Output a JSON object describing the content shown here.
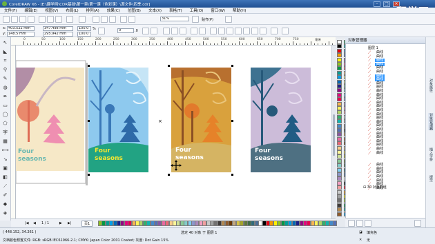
{
  "app": {
    "title": "CorelDRAW X6 - [E:\\翻学网\\CDR基础\\第一章\\第一课（色彩课）\\源文件\\四季.cdr]",
    "watermark": "翻学网",
    "watermark_sub": "qianxue.com"
  },
  "menu": [
    "文件(F)",
    "编辑(E)",
    "视图(V)",
    "布局(L)",
    "排列(A)",
    "效果(C)",
    "位图(B)",
    "文本(X)",
    "表格(T)",
    "工具(O)",
    "窗口(W)",
    "帮助(H)"
  ],
  "toolbar": {
    "zoom": "31%",
    "snap": "贴齐(P)",
    "angle": "0",
    "angle_unit": ".0"
  },
  "property_bar": {
    "x": "403.522 mm",
    "y": "148.5 mm",
    "width": "347.498 mm",
    "height": "295.942 mm",
    "scale_x": "100.0",
    "scale_y": "100.0",
    "scale_unit": "%"
  },
  "ruler": {
    "labels": [
      "0",
      "50",
      "100",
      "150",
      "200",
      "250",
      "300",
      "350",
      "400",
      "450",
      "500",
      "550",
      "600",
      "650",
      "700",
      "750",
      "毫米"
    ]
  },
  "cards": [
    {
      "title1": "Four",
      "title2": "seasons"
    },
    {
      "title1": "Four",
      "title2": "seasons"
    },
    {
      "title1": "Four",
      "title2": "seasons"
    },
    {
      "title1": "Four",
      "title2": "seasons"
    }
  ],
  "docker": {
    "title": "对象管理器",
    "header_layer": "图层 1",
    "group_label": "30 对象群组",
    "items": [
      {
        "label": "曲线",
        "selected": false
      },
      {
        "label": "曲线",
        "selected": false
      },
      {
        "label": "曲线",
        "selected": true
      },
      {
        "label": "曲线",
        "selected": true
      },
      {
        "label": "曲线",
        "selected": false
      },
      {
        "label": "曲线",
        "selected": false
      },
      {
        "label": "曲线",
        "selected": true
      },
      {
        "label": "曲线",
        "selected": true
      },
      {
        "label": "曲线",
        "selected": false
      },
      {
        "label": "曲线",
        "selected": false
      },
      {
        "label": "曲线",
        "selected": false
      },
      {
        "label": "曲线",
        "selected": false
      },
      {
        "label": "曲线",
        "selected": false
      },
      {
        "label": "曲线",
        "selected": false
      },
      {
        "label": "曲线",
        "selected": false
      },
      {
        "label": "曲线",
        "selected": false
      },
      {
        "label": "曲线",
        "selected": false
      },
      {
        "label": "曲线",
        "selected": false
      },
      {
        "label": "曲线",
        "selected": false
      },
      {
        "label": "曲线",
        "selected": false
      },
      {
        "label": "曲线",
        "selected": false
      },
      {
        "label": "曲线",
        "selected": false
      },
      {
        "label": "曲线",
        "selected": false
      },
      {
        "label": "曲线",
        "selected": false
      },
      {
        "label": "曲线",
        "selected": false
      },
      {
        "label": "曲线",
        "selected": false
      },
      {
        "label": "曲线",
        "selected": false
      },
      {
        "label": "曲线",
        "selected": false
      },
      {
        "label": "曲线",
        "selected": false
      },
      {
        "label": "曲线",
        "selected": false
      },
      {
        "label": "曲线",
        "selected": false
      },
      {
        "label": "曲线",
        "selected": false
      },
      {
        "label": "曲线",
        "selected": false
      },
      {
        "label": "曲线",
        "selected": false
      }
    ]
  },
  "right_tabs": [
    "对象属性",
    "对象管理器",
    "插入字符",
    "提示"
  ],
  "pages": {
    "current": "1 / 1",
    "tab": "页1"
  },
  "status": {
    "coords": "( 448.152, 34.261 )",
    "selection": "选定 40 对象 于 图层 1",
    "color_profile": "文档颜色预置文件: RGB: sRGB IEC61966-2.1; CMYK: Japan Color 2001 Coated; 灰度: Dot Gain 15%",
    "fill": "填充色",
    "outline": "无"
  },
  "palette": [
    "#ffffff",
    "#000000",
    "#e60012",
    "#f39800",
    "#fff100",
    "#8fc31f",
    "#009944",
    "#009e96",
    "#00a0e9",
    "#0068b7",
    "#1d2088",
    "#920783",
    "#e4007f",
    "#e5004f",
    "#f8b551",
    "#fff45c",
    "#b3d465",
    "#32b16c",
    "#13b5b1",
    "#448aca",
    "#556fb5",
    "#8957a1",
    "#ea68a2",
    "#eb6877",
    "#facd89",
    "#fff799",
    "#cce198",
    "#89c997",
    "#84ccc9",
    "#7ecef4",
    "#8c97cb",
    "#aa89bd",
    "#f19ec2",
    "#f19fa0",
    "#c9caca",
    "#9fa0a0",
    "#727171",
    "#3e3a39",
    "#b28850",
    "#8f5a2b",
    "#6a3906",
    "#c4a77d",
    "#d7c447",
    "#a5a529",
    "#5f7a3a",
    "#3e6b48",
    "#2f6a78",
    "#4a6e97"
  ]
}
